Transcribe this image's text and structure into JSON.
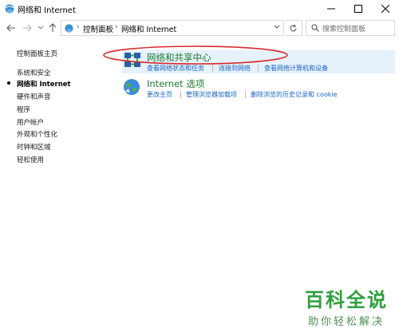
{
  "window": {
    "title": "网络和 Internet",
    "controls": {
      "minimize": "—",
      "maximize": "☐",
      "close": "✕"
    }
  },
  "address_bar": {
    "crumbs": [
      "控制面板",
      "网络和 Internet"
    ],
    "search_placeholder": "搜索控制面板"
  },
  "sidebar": {
    "items": [
      {
        "label": "控制面板主页",
        "current": false
      },
      {
        "label": "系统和安全",
        "current": false
      },
      {
        "label": "网络和 Internet",
        "current": true
      },
      {
        "label": "硬件和声音",
        "current": false
      },
      {
        "label": "程序",
        "current": false
      },
      {
        "label": "用户帐户",
        "current": false
      },
      {
        "label": "外观和个性化",
        "current": false
      },
      {
        "label": "时钟和区域",
        "current": false
      },
      {
        "label": "轻松使用",
        "current": false
      }
    ]
  },
  "main": {
    "items": [
      {
        "title": "网络和共享中心",
        "icon": "network-sharing-center-icon",
        "links": [
          "查看网络状态和任务",
          "连接到网络",
          "查看网络计算机和设备"
        ]
      },
      {
        "title": "Internet 选项",
        "icon": "internet-options-globe-icon",
        "links": [
          "更改主页",
          "管理浏览器加载项",
          "删除浏览的历史记录和 cookie"
        ]
      }
    ]
  },
  "watermark": {
    "title": "百科全说",
    "subtitle": "助你轻松解决"
  },
  "colors": {
    "link": "#1b63c5",
    "item_title": "#1e7b2e",
    "highlight": "#e5f1fb",
    "annotation_ellipse": "#d62b2b",
    "watermark": "#2f9f3c"
  }
}
